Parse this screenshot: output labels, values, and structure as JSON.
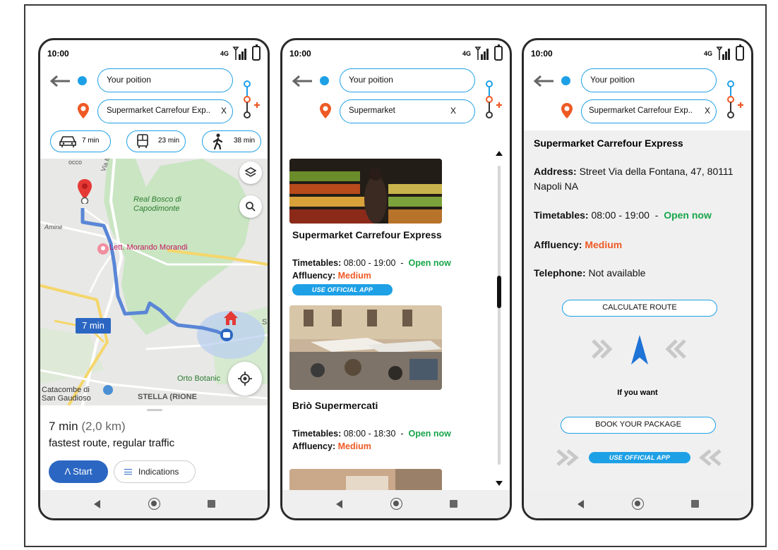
{
  "common": {
    "time": "10:00",
    "network": "4G",
    "origin_input": "Your poition",
    "colors": {
      "accent_blue": "#1ea0e6",
      "brand_blue": "#2b67c2",
      "open_green": "#18a54a",
      "medium_orange": "#ee5a24",
      "pin_orange": "#ee5a24"
    }
  },
  "screen1": {
    "destination_input": "Supermarket Carrefour Exp..",
    "clear": "X",
    "modes": [
      {
        "icon": "car-icon",
        "label": "7 min"
      },
      {
        "icon": "bus-icon",
        "label": "23 min"
      },
      {
        "icon": "walk-icon",
        "label": "38 min"
      }
    ],
    "map": {
      "labels": {
        "park": "Real Bosco di Capodimonte",
        "poi": "Lett. Morando Morandi",
        "botanic": "Orto Botanic",
        "catacombe": "Catacombe di San Gaudioso",
        "stella": "STELLA (RIONE",
        "road": "Via Miano",
        "street": "Amine",
        "top": "occo",
        "edge": "S"
      },
      "route_badge": "7 min"
    },
    "sheet": {
      "duration": "7 min",
      "distance": "(2,0 km)",
      "traffic": "fastest route, regular traffic",
      "start_label": "Start",
      "indications_label": "Indications"
    }
  },
  "screen2": {
    "destination_input": "Supermarket",
    "clear": "X",
    "results": [
      {
        "name": "Supermarket Carrefour Express",
        "timetables_label": "Timetables:",
        "hours": "08:00 - 19:00",
        "sep": "-",
        "status": "Open now",
        "affluency_label": "Affluency:",
        "affluency": "Medium",
        "app_label": "USE OFFICIAL APP"
      },
      {
        "name": "Briò Supermercati",
        "timetables_label": "Timetables:",
        "hours": "08:00 - 18:30",
        "sep": "-",
        "status": "Open now",
        "affluency_label": "Affluency:",
        "affluency": "Medium"
      }
    ]
  },
  "screen3": {
    "destination_input": "Supermarket Carrefour Exp..",
    "clear": "X",
    "title": "Supermarket Carrefour Express",
    "address_label": "Address:",
    "address": "Street Via della Fontana, 47, 80111 Napoli NA",
    "timetables_label": "Timetables:",
    "hours": "08:00 - 19:00",
    "sep": "-",
    "status": "Open now",
    "affluency_label": "Affluency:",
    "affluency": "Medium",
    "telephone_label": "Telephone:",
    "telephone": "Not available",
    "calculate_label": "CALCULATE ROUTE",
    "if_you_want": "If you want",
    "book_label": "BOOK YOUR PACKAGE",
    "app_label": "USE OFFICIAL APP"
  }
}
